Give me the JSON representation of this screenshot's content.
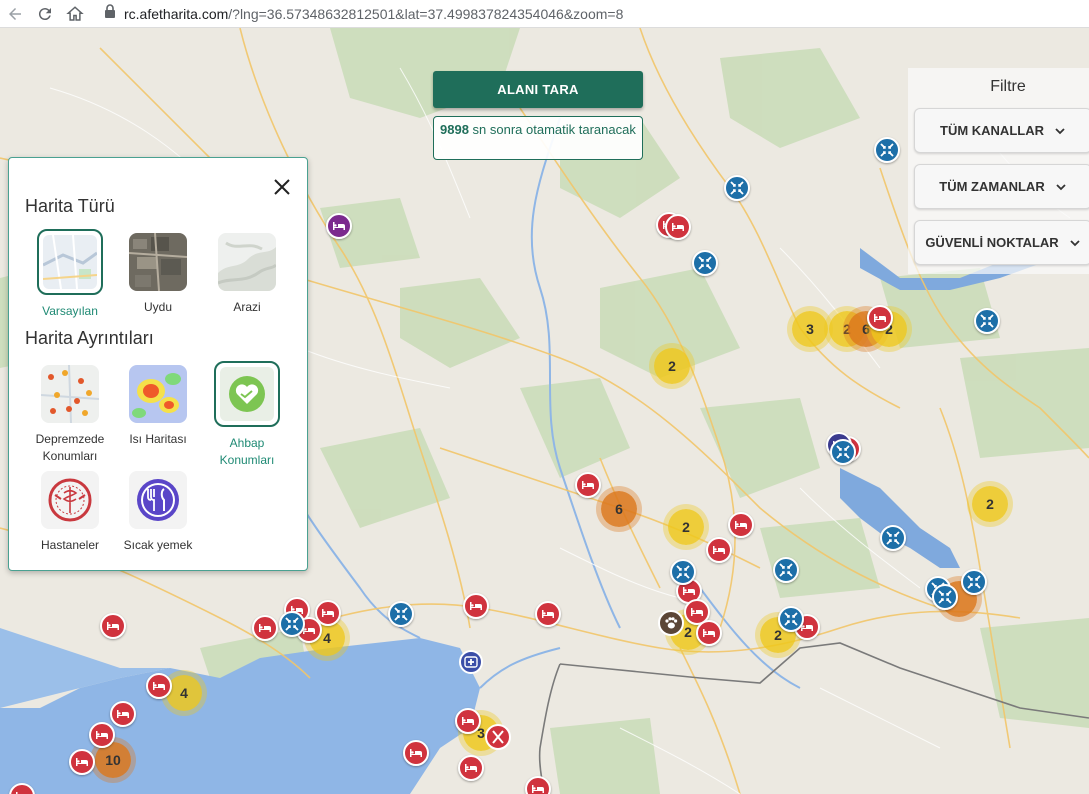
{
  "browser": {
    "url_host": "rc.afetharita.com",
    "url_path": "/?lng=36.57348632812501&lat=37.499837824354046&zoom=8"
  },
  "scan": {
    "button_label": "ALANI TARA",
    "countdown_value": "9898",
    "countdown_text": "sn sonra otamatik taranacak"
  },
  "filter": {
    "title": "Filtre",
    "buttons": [
      "TÜM KANALLAR",
      "TÜM ZAMANLAR",
      "GÜVENLİ NOKTALAR"
    ]
  },
  "maptype_panel": {
    "section_map_type": "Harita Türü",
    "map_types": [
      {
        "label": "Varsayılan",
        "selected": true
      },
      {
        "label": "Uydu",
        "selected": false
      },
      {
        "label": "Arazi",
        "selected": false
      }
    ],
    "section_details": "Harita Ayrıntıları",
    "details": [
      {
        "label": "Depremzede Konumları",
        "selected": false
      },
      {
        "label": "Isı Haritası",
        "selected": false
      },
      {
        "label": "Ahbap Konumları",
        "selected": true
      },
      {
        "label": "Hastaneler",
        "selected": false
      },
      {
        "label": "Sıcak yemek",
        "selected": false
      }
    ]
  },
  "clusters": [
    "3",
    "2",
    "6",
    "2",
    "2",
    "6",
    "2",
    "2",
    "2",
    "2",
    "4",
    "4",
    "3",
    "10"
  ],
  "colors": {
    "accent": "#1f6e5a",
    "bed_marker": "#d0333e",
    "blue_marker": "#1d6fa8",
    "cluster_yellow": "#eec81c",
    "cluster_orange": "#dc781c"
  }
}
